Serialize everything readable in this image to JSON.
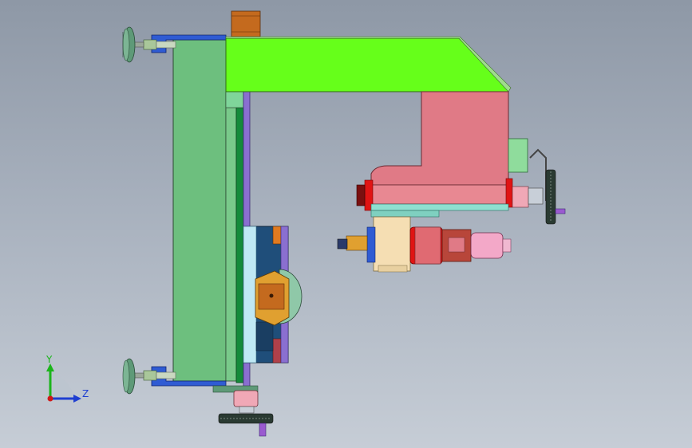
{
  "viewport": {
    "background_top": "#8e98a6",
    "background_bottom": "#c6cdd6"
  },
  "model": {
    "parts": [
      "leveling-foot-top",
      "leveling-foot-bottom",
      "base-column",
      "c-frame-arm",
      "spindle-head",
      "lower-spindle-unit",
      "vise-block",
      "cross-slide",
      "handwheel-right",
      "handwheel-bottom",
      "motor-block"
    ],
    "colors": {
      "column": "#6dbf7e",
      "arm": "#66ff1a",
      "head": "#e07a86",
      "vise": "#1f4e7a",
      "slide_tan": "#f5deb3",
      "bracket_blue": "#2f5bd3",
      "motor_orange": "#c46a1e"
    }
  },
  "triad": {
    "y_label": "Y",
    "z_label": "Z",
    "y_color": "#1bb51b",
    "z_color": "#1f3fd1",
    "x_color": "#d01818"
  }
}
